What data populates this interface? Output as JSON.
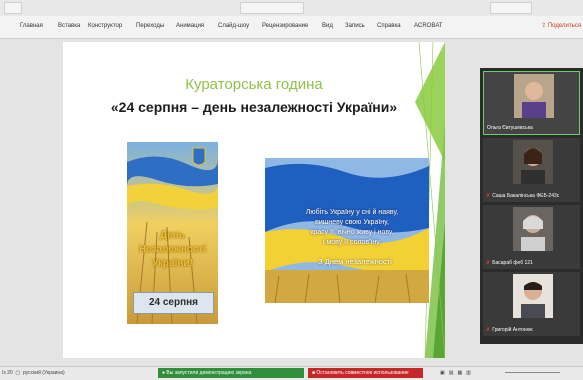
{
  "ribbon": {
    "tabs": [
      "Главная",
      "Вставка",
      "Конструктор",
      "Переходы",
      "Анимация",
      "Слайд-шоу",
      "Рецензирование",
      "Вид",
      "Запись",
      "Справка",
      "ACROBAT"
    ],
    "share_label": "Поделиться"
  },
  "slide": {
    "title_line1": "Кураторська година",
    "title_line2": "«24 серпня – день незалежності України»",
    "image1": {
      "line1": "День",
      "line2": "Незалежності",
      "line3": "України!",
      "date": "24 серпня"
    },
    "image2": {
      "poem": [
        "Любіть Україну у сні й наяву,",
        "вишневу свою Україну,",
        "красу її, вічно живу і нову,",
        "і мову її солов'їну."
      ],
      "greeting": "З Днем незалежності"
    }
  },
  "participants": [
    {
      "name": "Ольга Євтушевська",
      "muted": false
    },
    {
      "name": "Саша Бакалінська ФЕБ-243с",
      "muted": true
    },
    {
      "name": "Басараб феб 121",
      "muted": true
    },
    {
      "name": "Григорій Антонюк",
      "muted": true
    }
  ],
  "status": {
    "slide_info": "Із 20",
    "language": "русский (Украина)",
    "sharing_notice": "Вы запустили демонстрацию экрана",
    "stop_sharing": "Остановить совместное использование"
  },
  "colors": {
    "accent_green": "#8fc24a",
    "share_green": "#2f8f3a",
    "stop_red": "#c62828",
    "brand_orange": "#c43e1c"
  }
}
